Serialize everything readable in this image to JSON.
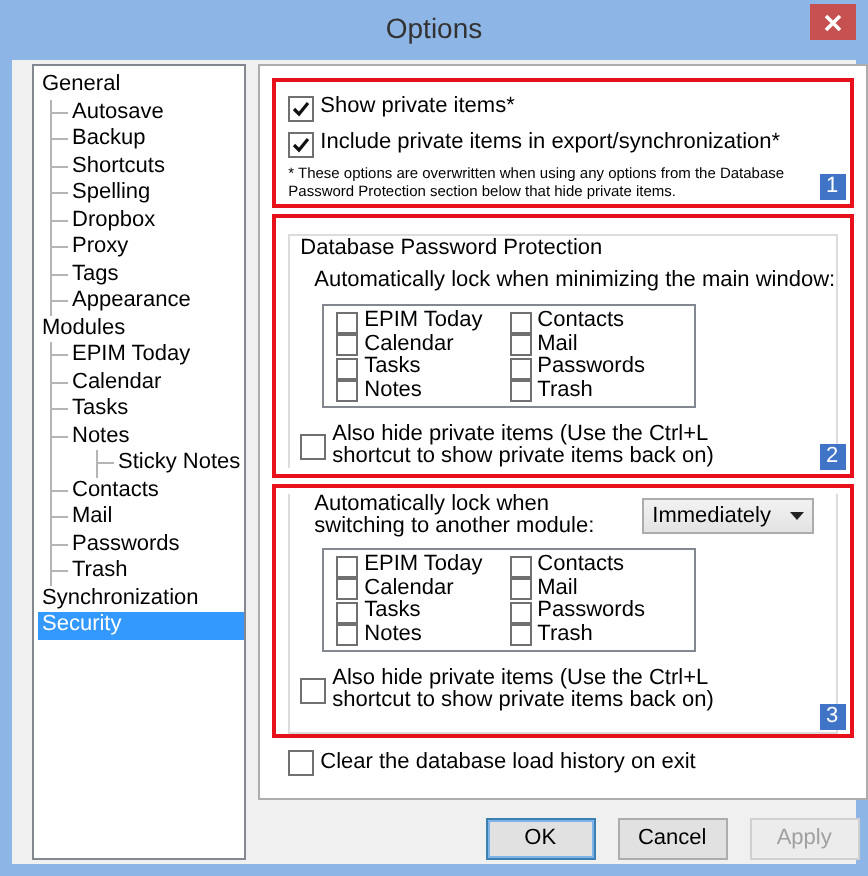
{
  "window": {
    "title": "Options"
  },
  "tree": [
    {
      "label": "General",
      "selected": false,
      "children": [
        {
          "label": "Autosave",
          "selected": false
        },
        {
          "label": "Backup",
          "selected": false
        },
        {
          "label": "Shortcuts",
          "selected": false
        },
        {
          "label": "Spelling",
          "selected": false
        },
        {
          "label": "Dropbox",
          "selected": false
        },
        {
          "label": "Proxy",
          "selected": false
        },
        {
          "label": "Tags",
          "selected": false
        },
        {
          "label": "Appearance",
          "selected": false
        }
      ]
    },
    {
      "label": "Modules",
      "selected": false,
      "children": [
        {
          "label": "EPIM Today",
          "selected": false
        },
        {
          "label": "Calendar",
          "selected": false
        },
        {
          "label": "Tasks",
          "selected": false
        },
        {
          "label": "Notes",
          "selected": false,
          "children": [
            {
              "label": "Sticky Notes",
              "selected": false
            }
          ]
        },
        {
          "label": "Contacts",
          "selected": false
        },
        {
          "label": "Mail",
          "selected": false
        },
        {
          "label": "Passwords",
          "selected": false
        },
        {
          "label": "Trash",
          "selected": false
        }
      ]
    },
    {
      "label": "Synchronization",
      "selected": false
    },
    {
      "label": "Security",
      "selected": true
    }
  ],
  "private_section": {
    "badge": "1",
    "options": [
      {
        "label": "Show private items*",
        "checked": true
      },
      {
        "label": "Include private items in export/synchronization*",
        "checked": true
      }
    ],
    "note": "* These options are overwritten when using any options from the Database Password Protection section below that hide private items."
  },
  "group_title": "Database Password Protection",
  "minimize_section": {
    "badge": "2",
    "label": "Automatically lock when minimizing the main window:",
    "modules": [
      {
        "label": "EPIM Today",
        "checked": false
      },
      {
        "label": "Calendar",
        "checked": false
      },
      {
        "label": "Tasks",
        "checked": false
      },
      {
        "label": "Notes",
        "checked": false
      },
      {
        "label": "Contacts",
        "checked": false
      },
      {
        "label": "Mail",
        "checked": false
      },
      {
        "label": "Passwords",
        "checked": false
      },
      {
        "label": "Trash",
        "checked": false
      }
    ],
    "hide_private": {
      "label": "Also hide private items (Use the Ctrl+L shortcut to show private items back on)",
      "checked": false
    }
  },
  "switch_section": {
    "badge": "3",
    "label": "Automatically lock when switching to another module:",
    "select": "Immediately",
    "modules": [
      {
        "label": "EPIM Today",
        "checked": false
      },
      {
        "label": "Calendar",
        "checked": false
      },
      {
        "label": "Tasks",
        "checked": false
      },
      {
        "label": "Notes",
        "checked": false
      },
      {
        "label": "Contacts",
        "checked": false
      },
      {
        "label": "Mail",
        "checked": false
      },
      {
        "label": "Passwords",
        "checked": false
      },
      {
        "label": "Trash",
        "checked": false
      }
    ],
    "hide_private": {
      "label": "Also hide private items (Use the Ctrl+L shortcut to show private items back on)",
      "checked": false
    }
  },
  "clear_history": {
    "label": "Clear the database load history on exit",
    "checked": false
  },
  "buttons": [
    {
      "label": "OK",
      "default": true,
      "disabled": false
    },
    {
      "label": "Cancel",
      "default": false,
      "disabled": false
    },
    {
      "label": "Apply",
      "default": false,
      "disabled": true
    }
  ]
}
